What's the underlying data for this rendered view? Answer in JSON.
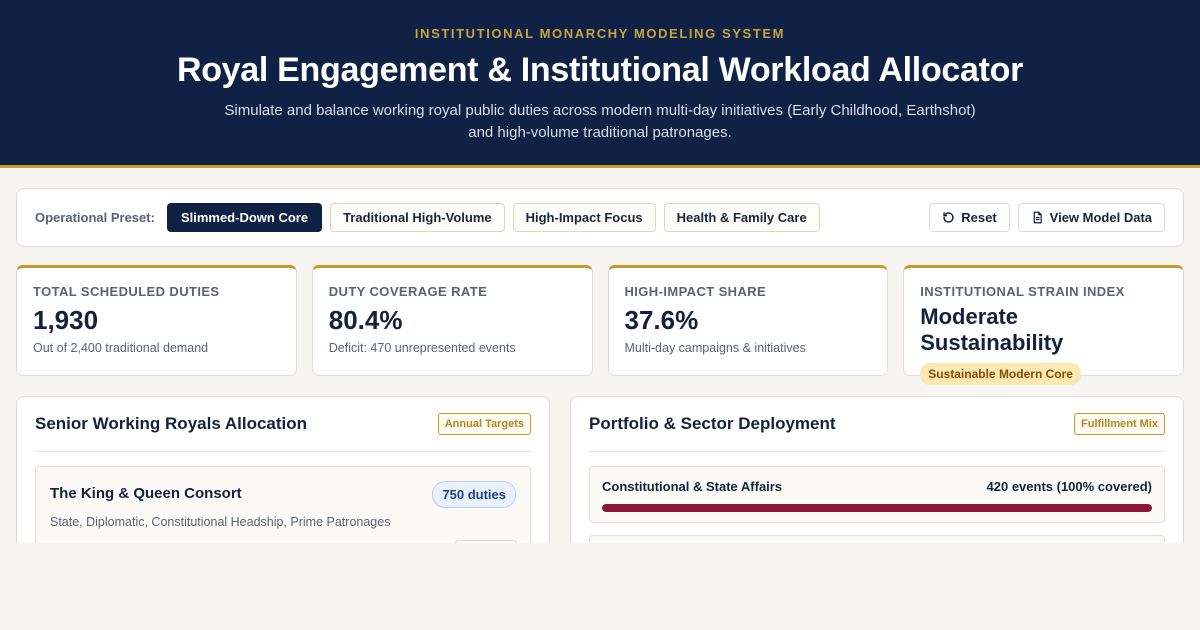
{
  "header": {
    "kicker": "INSTITUTIONAL MONARCHY MODELING SYSTEM",
    "title": "Royal Engagement & Institutional Workload Allocator",
    "subtitle": "Simulate and balance working royal public duties across modern multi-day initiatives (Early Childhood, Earthshot) and high-volume traditional patronages."
  },
  "toolbar": {
    "label": "Operational Preset:",
    "presets": [
      {
        "label": "Slimmed-Down Core",
        "active": true
      },
      {
        "label": "Traditional High-Volume",
        "active": false
      },
      {
        "label": "High-Impact Focus",
        "active": false
      },
      {
        "label": "Health & Family Care",
        "active": false
      }
    ],
    "reset_label": "Reset",
    "view_data_label": "View Model Data"
  },
  "kpis": [
    {
      "label": "TOTAL SCHEDULED DUTIES",
      "value": "1,930",
      "note": "Out of 2,400 traditional demand"
    },
    {
      "label": "DUTY COVERAGE RATE",
      "value": "80.4%",
      "note": "Deficit: 470 unrepresented events"
    },
    {
      "label": "HIGH-IMPACT SHARE",
      "value": "37.6%",
      "note": "Multi-day campaigns & initiatives"
    },
    {
      "label": "INSTITUTIONAL STRAIN INDEX",
      "value": "Moderate Sustainability",
      "badge": "Sustainable Modern Core"
    }
  ],
  "royals_panel": {
    "title": "Senior Working Royals Allocation",
    "tag": "Annual Targets",
    "cards": [
      {
        "name": "The King & Queen Consort",
        "duties": "750 duties",
        "desc": "State, Diplomatic, Constitutional Headship, Prime Patronages"
      }
    ]
  },
  "sectors_panel": {
    "title": "Portfolio & Sector Deployment",
    "tag": "Fulfillment Mix",
    "sectors": [
      {
        "name": "Constitutional & State Affairs",
        "summary": "420 events (100% covered)",
        "coverage": 1.0
      }
    ]
  },
  "colors": {
    "navy": "#0f2246",
    "gold": "#c49a2c",
    "bar": "#8a1538"
  }
}
